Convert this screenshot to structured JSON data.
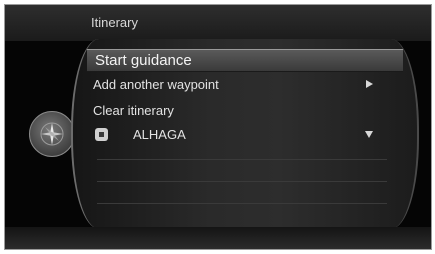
{
  "header": {
    "title": "Itinerary"
  },
  "menu": {
    "items": [
      {
        "label": "Start guidance",
        "selected": true
      },
      {
        "label": "Add another waypoint",
        "icon": "arrow-right-icon"
      },
      {
        "label": "Clear itinerary"
      }
    ],
    "waypoints": [
      {
        "name": "ALHAGA",
        "icon": "waypoint-square-icon",
        "expand_icon": "arrow-down-icon"
      }
    ]
  },
  "side_icon": "compass-icon",
  "colors": {
    "background": "#050505",
    "panel": "#2a2a2a",
    "text": "#e2e2e2",
    "highlight": "#5a5a5a"
  }
}
